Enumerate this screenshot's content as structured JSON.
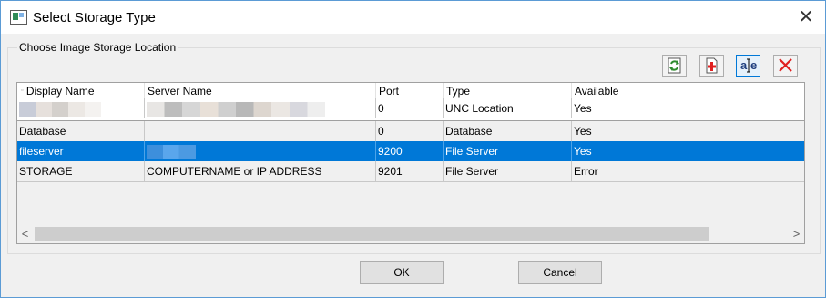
{
  "window": {
    "title": "Select Storage Type"
  },
  "group": {
    "label": "Choose Image Storage Location"
  },
  "toolbar": {
    "buttons": [
      {
        "name": "refresh-button",
        "icon": "refresh-icon"
      },
      {
        "name": "add-button",
        "icon": "add-document-icon"
      },
      {
        "name": "rename-button",
        "icon": "text-edit-icon"
      },
      {
        "name": "delete-button",
        "icon": "delete-x-icon"
      }
    ]
  },
  "grid": {
    "columns": [
      "Display Name",
      "Server Name",
      "Port",
      "Type",
      "Available"
    ],
    "rows": [
      {
        "display_name": "",
        "server_name": "",
        "port": "0",
        "type": "UNC Location",
        "available": "Yes",
        "redacted": true
      },
      {
        "display_name": "Database",
        "server_name": "",
        "port": "0",
        "type": "Database",
        "available": "Yes"
      },
      {
        "display_name": "fileserver",
        "server_name": "",
        "port": "9200",
        "type": "File Server",
        "available": "Yes",
        "selected": true
      },
      {
        "display_name": "STORAGE",
        "server_name": "COMPUTERNAME or IP ADDRESS",
        "port": "9201",
        "type": "File Server",
        "available": "Error"
      }
    ],
    "scroll_left": "<",
    "scroll_right": ">"
  },
  "buttons": {
    "ok": "OK",
    "cancel": "Cancel"
  },
  "colors": {
    "selection": "#0078d7",
    "window_border": "#5b9bd5",
    "delete_icon": "#e02020",
    "add_icon": "#e02020",
    "refresh_icon": "#2e8b2e"
  }
}
